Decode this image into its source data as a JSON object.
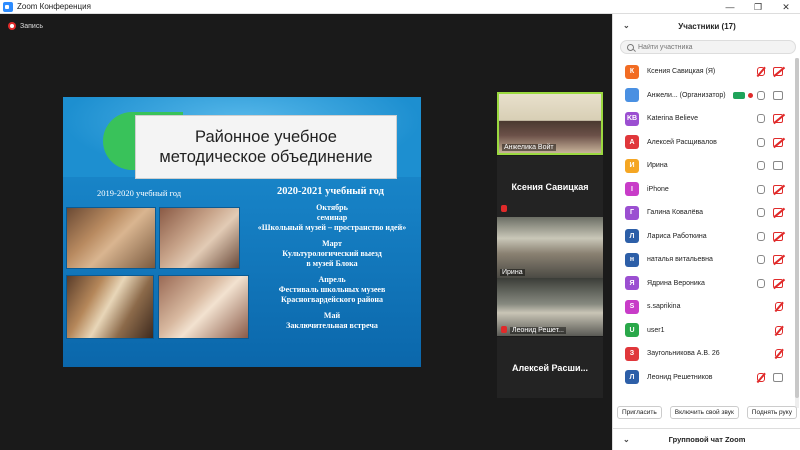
{
  "window": {
    "title": "Zoom Конференция",
    "buttons": [
      "—",
      "❐",
      "✕"
    ]
  },
  "recording": {
    "label": "Запись"
  },
  "slide": {
    "title_line1": "Районное учебное",
    "title_line2": "методическое объединение",
    "year_left": "2019-2020 учебный год",
    "year_right": "2020-2021 учебный год",
    "events": [
      "Октябрь",
      "семинар",
      "«Школьный музей – пространство идей»",
      "",
      "Март",
      "Культурологический выезд",
      "в музей Блока",
      "",
      "Апрель",
      "Фестиваль школьных музеев",
      "Красногвардейского района",
      "",
      "Май",
      "Заключительная встреча"
    ]
  },
  "video_tiles": [
    {
      "name": "Анжелика Войт",
      "type": "video",
      "active": true
    },
    {
      "name": "Ксения Савицкая",
      "type": "name-only",
      "muted": true
    },
    {
      "name": "Ирина",
      "type": "video"
    },
    {
      "name": "Леонид Решетников",
      "display": "Леонид Решет...",
      "type": "video",
      "muted": true
    },
    {
      "name": "Алексей Расши...",
      "type": "name-only"
    }
  ],
  "participants_panel": {
    "title": "Участники (17)",
    "search_placeholder": "Найти участника",
    "participants": [
      {
        "initial": "К",
        "color": "#f26c23",
        "name": "Ксения Савицкая (Я)",
        "mic": "muted",
        "cam": "off"
      },
      {
        "initial": "",
        "color": "#4a90e2",
        "name": "Анжели... (Организатор)",
        "mic": "on",
        "cam": "on",
        "host": true
      },
      {
        "initial": "KB",
        "color": "#9b4fd1",
        "name": "Katerina Believe",
        "mic": "on",
        "cam": "off"
      },
      {
        "initial": "А",
        "color": "#e0373b",
        "name": "Алексей Расщивалов",
        "mic": "on",
        "cam": "off"
      },
      {
        "initial": "И",
        "color": "#f5a623",
        "name": "Ирина",
        "mic": "on",
        "cam": "on"
      },
      {
        "initial": "I",
        "color": "#c83cc8",
        "name": "iPhone",
        "mic": "on",
        "cam": "off"
      },
      {
        "initial": "Г",
        "color": "#9b4fd1",
        "name": "Галина Ковалёва",
        "mic": "on",
        "cam": "off"
      },
      {
        "initial": "Л",
        "color": "#2d5fa8",
        "name": "Лариса Работкина",
        "mic": "on",
        "cam": "off"
      },
      {
        "initial": "н",
        "color": "#2d5fa8",
        "name": "наталья витальевна",
        "mic": "on",
        "cam": "off"
      },
      {
        "initial": "Я",
        "color": "#9b4fd1",
        "name": "Ядрина Вероника",
        "mic": "on",
        "cam": "off"
      },
      {
        "initial": "S",
        "color": "#c83cc8",
        "name": "s.saprikina",
        "mic": "muted-only"
      },
      {
        "initial": "U",
        "color": "#2aa84a",
        "name": "user1",
        "mic": "muted-only"
      },
      {
        "initial": "З",
        "color": "#e0373b",
        "name": "Заугольникова А.В. 26",
        "mic": "muted-only"
      },
      {
        "initial": "Л",
        "color": "#2d5fa8",
        "name": "Леонид Решетников",
        "mic": "muted",
        "cam": "on"
      }
    ],
    "actions": [
      "Пригласить",
      "Включить свой звук",
      "Поднять руку"
    ]
  },
  "chat": {
    "title": "Групповой чат Zoom"
  }
}
